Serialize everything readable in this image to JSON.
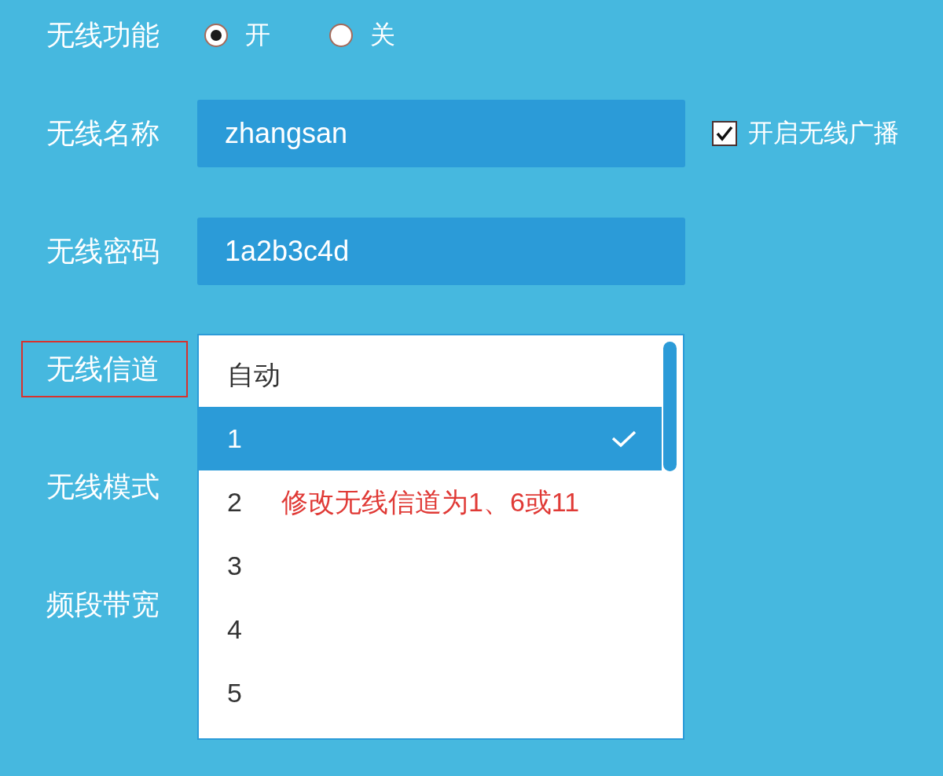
{
  "rows": [
    {
      "label": "无线功能",
      "kind": "radio",
      "highlighted": false,
      "options": [
        {
          "label": "开",
          "selected": true
        },
        {
          "label": "关",
          "selected": false
        }
      ]
    },
    {
      "label": "无线名称",
      "kind": "text",
      "highlighted": false,
      "value": "zhangsan",
      "checkbox": {
        "label": "开启无线广播",
        "checked": true
      }
    },
    {
      "label": "无线密码",
      "kind": "text",
      "highlighted": false,
      "value": "1a2b3c4d"
    },
    {
      "label": "无线信道",
      "kind": "dropdown",
      "highlighted": true,
      "options": [
        {
          "label": "自动",
          "selected": false
        },
        {
          "label": "1",
          "selected": true
        },
        {
          "label": "2",
          "selected": false
        },
        {
          "label": "3",
          "selected": false
        },
        {
          "label": "4",
          "selected": false
        },
        {
          "label": "5",
          "selected": false
        }
      ]
    },
    {
      "label": "无线模式",
      "kind": "covered",
      "highlighted": false
    },
    {
      "label": "频段带宽",
      "kind": "covered",
      "highlighted": false
    }
  ],
  "annotation": {
    "text": "修改无线信道为1、6或11"
  }
}
